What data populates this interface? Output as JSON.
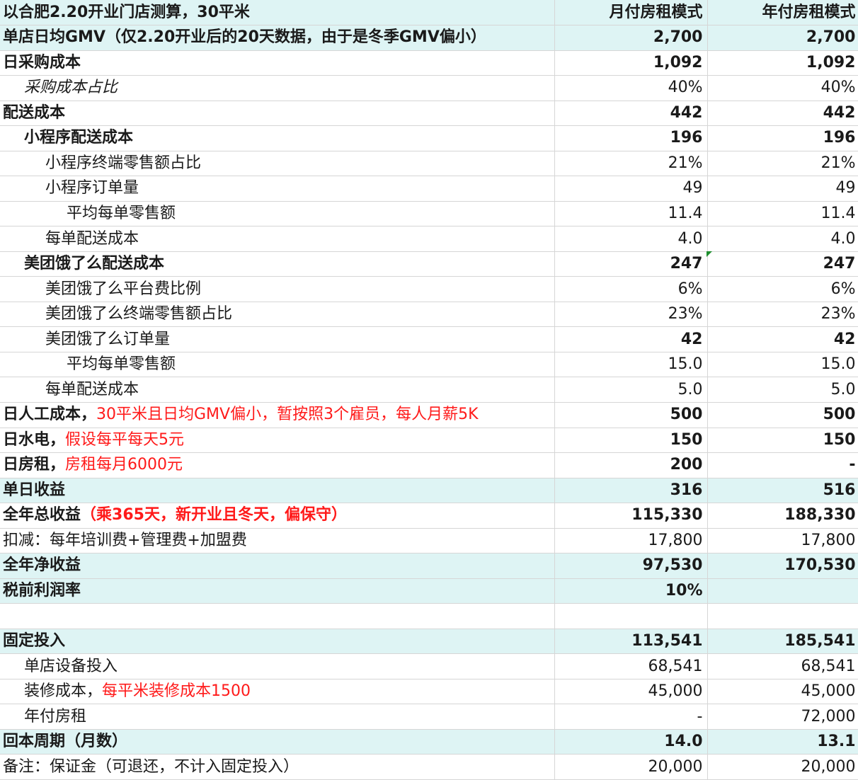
{
  "sheet": {
    "rows": [
      {
        "label": "以合肥2.20开业门店测算，30平米",
        "v1": "月付房租模式",
        "v2": "年付房租模式",
        "style": "hl bold",
        "indent": 0
      },
      {
        "label": "单店日均GMV（仅2.20开业后的20天数据，由于是冬季GMV偏小）",
        "v1": "2,700",
        "v2": "2,700",
        "style": "hl bold",
        "indent": 0
      },
      {
        "label": "日采购成本",
        "v1": "1,092",
        "v2": "1,092",
        "style": "bold",
        "indent": 0
      },
      {
        "label": "采购成本占比",
        "v1": "40%",
        "v2": "40%",
        "style": "italic",
        "indent": 1
      },
      {
        "label": "配送成本",
        "v1": "442",
        "v2": "442",
        "style": "bold",
        "indent": 0
      },
      {
        "label": "小程序配送成本",
        "v1": "196",
        "v2": "196",
        "style": "bold",
        "indent": 1
      },
      {
        "label": "小程序终端零售额占比",
        "v1": "21%",
        "v2": "21%",
        "style": "",
        "indent": 2
      },
      {
        "label": "小程序订单量",
        "v1": "49",
        "v2": "49",
        "style": "",
        "indent": 2
      },
      {
        "label": "平均每单零售额",
        "v1": "11.4",
        "v2": "11.4",
        "style": "",
        "indent": 3
      },
      {
        "label": "每单配送成本",
        "v1": "4.0",
        "v2": "4.0",
        "style": "",
        "indent": 2,
        "valRed": true
      },
      {
        "label": "美团饿了么配送成本",
        "v1": "247",
        "v2": "247",
        "style": "bold",
        "indent": 1
      },
      {
        "label": "美团饿了么平台费比例",
        "v1": "6%",
        "v2": "6%",
        "style": "",
        "indent": 2
      },
      {
        "label": "美团饿了么终端零售额占比",
        "v1": "23%",
        "v2": "23%",
        "style": "",
        "indent": 2
      },
      {
        "label": "美团饿了么订单量",
        "v1": "42",
        "v2": "42",
        "style": "valbold",
        "indent": 2
      },
      {
        "label": "平均每单零售额",
        "v1": "15.0",
        "v2": "15.0",
        "style": "",
        "indent": 3,
        "valRed": true
      },
      {
        "label": "每单配送成本",
        "v1": "5.0",
        "v2": "5.0",
        "style": "",
        "indent": 2,
        "valRed": true
      },
      {
        "label": "日人工成本，",
        "note": "30平米且日均GMV偏小，暂按照3个雇员，每人月薪5K",
        "v1": "500",
        "v2": "500",
        "style": "bold",
        "indent": 0
      },
      {
        "label": "日水电，",
        "note": "假设每平每天5元",
        "v1": "150",
        "v2": "150",
        "style": "bold",
        "indent": 0
      },
      {
        "label": "日房租，",
        "note": "房租每月6000元",
        "v1": "200",
        "v2": "-",
        "style": "bold",
        "indent": 0
      },
      {
        "label": "单日收益",
        "v1": "316",
        "v2": "516",
        "style": "hl bold",
        "indent": 0
      },
      {
        "label": "全年总收益",
        "noteBold": "（乘365天，新开业且冬天，偏保守）",
        "v1": "115,330",
        "v2": "188,330",
        "style": "bold",
        "indent": 0
      },
      {
        "label": "扣减：每年培训费+管理费+加盟费",
        "v1": "17,800",
        "v2": "17,800",
        "style": "",
        "indent": 0
      },
      {
        "label": "全年净收益",
        "v1": "97,530",
        "v2": "170,530",
        "style": "hl bold",
        "indent": 0
      },
      {
        "label": "税前利润率",
        "v1": "10%",
        "v2": "",
        "style": "hl bold",
        "indent": 0
      },
      {
        "label": "",
        "v1": "",
        "v2": "",
        "style": "",
        "indent": 0
      },
      {
        "label": "固定投入",
        "v1": "113,541",
        "v2": "185,541",
        "style": "hl bold",
        "indent": 0
      },
      {
        "label": "单店设备投入",
        "v1": "68,541",
        "v2": "68,541",
        "style": "",
        "indent": 1
      },
      {
        "label": "装修成本，",
        "note": "每平米装修成本1500",
        "v1": "45,000",
        "v2": "45,000",
        "style": "",
        "indent": 1
      },
      {
        "label": "年付房租",
        "v1": "-",
        "v2": "72,000",
        "style": "",
        "indent": 1
      },
      {
        "label": "回本周期（月数）",
        "v1": "14.0",
        "v2": "13.1",
        "style": "hl bold",
        "indent": 0
      },
      {
        "label": "备注：保证金（可退还，不计入固定投入）",
        "v1": "20,000",
        "v2": "20,000",
        "style": "",
        "indent": 0
      }
    ]
  },
  "colors": {
    "highlight": "#def4f4",
    "note_red": "#ff1a1a",
    "comment_marker": "#1f8f2f"
  }
}
